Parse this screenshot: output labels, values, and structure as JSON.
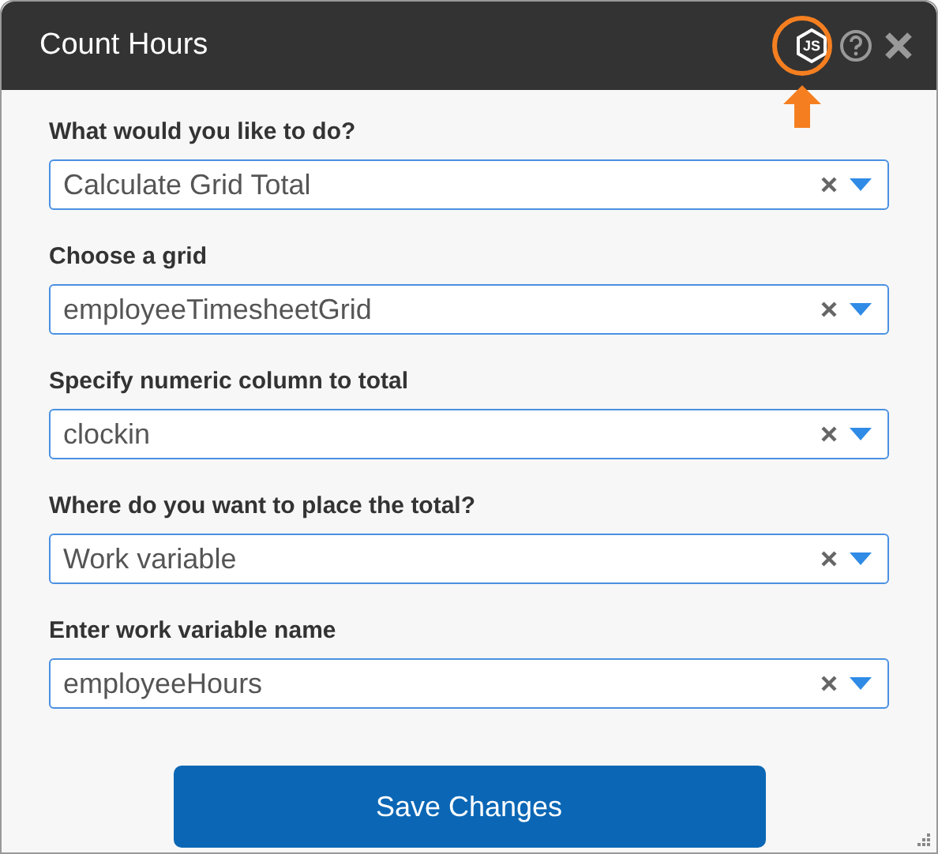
{
  "window": {
    "title": "Count Hours",
    "logo_text": "JS",
    "highlighted": true
  },
  "fields": [
    {
      "label": "What would you like to do?",
      "value": "Calculate Grid Total"
    },
    {
      "label": "Choose a grid",
      "value": "employeeTimesheetGrid"
    },
    {
      "label": "Specify numeric column to total",
      "value": "clockin"
    },
    {
      "label": "Where do you want to place the total?",
      "value": "Work variable"
    },
    {
      "label": "Enter work variable name",
      "value": "employeeHours"
    }
  ],
  "save_button": "Save Changes"
}
